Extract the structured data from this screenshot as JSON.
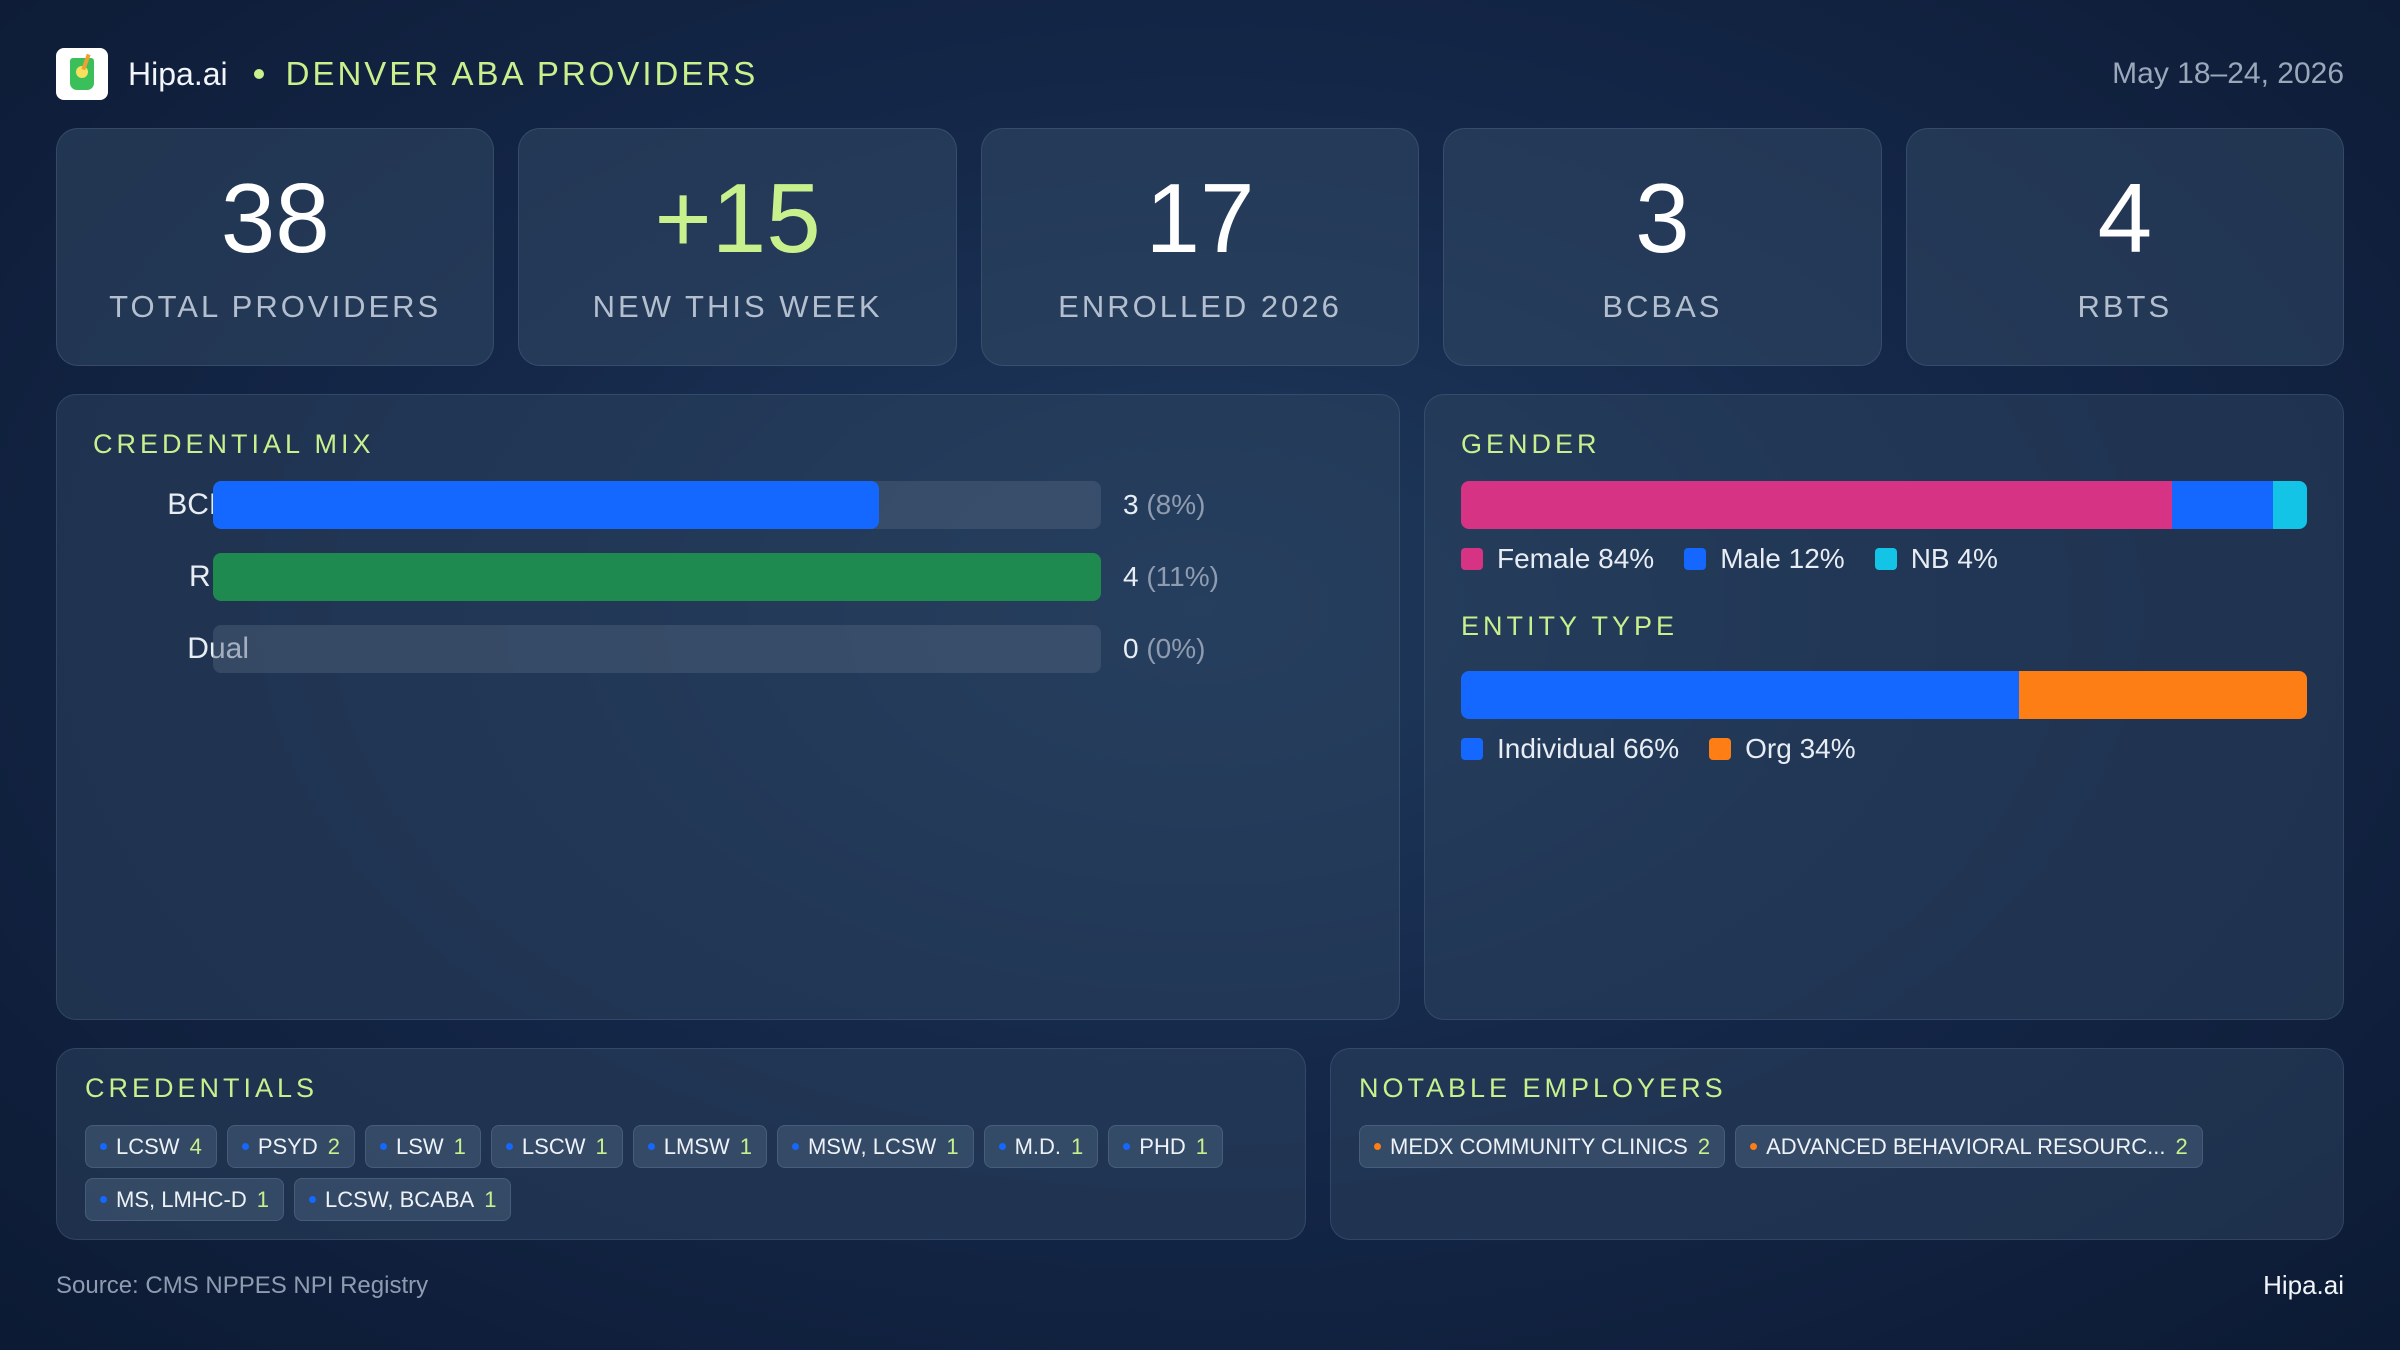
{
  "header": {
    "brand": "Hipa.ai",
    "title": "DENVER ABA PROVIDERS",
    "date_range": "May 18–24, 2026",
    "logo_icon": "cup-icon"
  },
  "kpis": [
    {
      "value": "38",
      "label": "TOTAL PROVIDERS",
      "accent": false
    },
    {
      "value": "+15",
      "label": "NEW THIS WEEK",
      "accent": true
    },
    {
      "value": "17",
      "label": "ENROLLED 2026",
      "accent": false
    },
    {
      "value": "3",
      "label": "BCBAS",
      "accent": false
    },
    {
      "value": "4",
      "label": "RBTS",
      "accent": false
    }
  ],
  "credential_mix": {
    "title": "CREDENTIAL MIX",
    "rows": [
      {
        "label": "BCBA",
        "count": "3",
        "pct": "(8%)",
        "fill_fraction": 0.75,
        "color": "#1468ff"
      },
      {
        "label": "RBT",
        "count": "4",
        "pct": "(11%)",
        "fill_fraction": 1.0,
        "color": "#1f8a50"
      },
      {
        "label": "Dual",
        "count": "0",
        "pct": "(0%)",
        "fill_fraction": 0.0,
        "color": "#1468ff"
      }
    ]
  },
  "gender": {
    "title": "GENDER",
    "segments": [
      {
        "label": "Female 84%",
        "share": 84,
        "color": "#d63384"
      },
      {
        "label": "Male 12%",
        "share": 12,
        "color": "#1468ff"
      },
      {
        "label": "NB 4%",
        "share": 4,
        "color": "#14c4e6"
      }
    ]
  },
  "entity_type": {
    "title": "ENTITY TYPE",
    "segments": [
      {
        "label": "Individual 66%",
        "share": 66,
        "color": "#1468ff"
      },
      {
        "label": "Org 34%",
        "share": 34,
        "color": "#fd7e14"
      }
    ]
  },
  "credentials": {
    "title": "CREDENTIALS",
    "dot_color": "#1468ff",
    "chips": [
      {
        "name": "LCSW",
        "count": "4"
      },
      {
        "name": "PSYD",
        "count": "2"
      },
      {
        "name": "LSW",
        "count": "1"
      },
      {
        "name": "LSCW",
        "count": "1"
      },
      {
        "name": "LMSW",
        "count": "1"
      },
      {
        "name": "MSW, LCSW",
        "count": "1"
      },
      {
        "name": "M.D.",
        "count": "1"
      },
      {
        "name": "PHD",
        "count": "1"
      },
      {
        "name": "MS, LMHC-D",
        "count": "1"
      },
      {
        "name": "LCSW, BCABA",
        "count": "1"
      }
    ]
  },
  "employers": {
    "title": "NOTABLE EMPLOYERS",
    "dot_color": "#fd7e14",
    "chips": [
      {
        "name": "MEDX COMMUNITY CLINICS",
        "count": "2"
      },
      {
        "name": "ADVANCED BEHAVIORAL RESOURC...",
        "count": "2"
      }
    ]
  },
  "footer": {
    "source": "Source: CMS NPPES NPI Registry",
    "brand": "Hipa.ai"
  },
  "colors": {
    "accent": "#c8f08c",
    "background": "#15284a"
  }
}
